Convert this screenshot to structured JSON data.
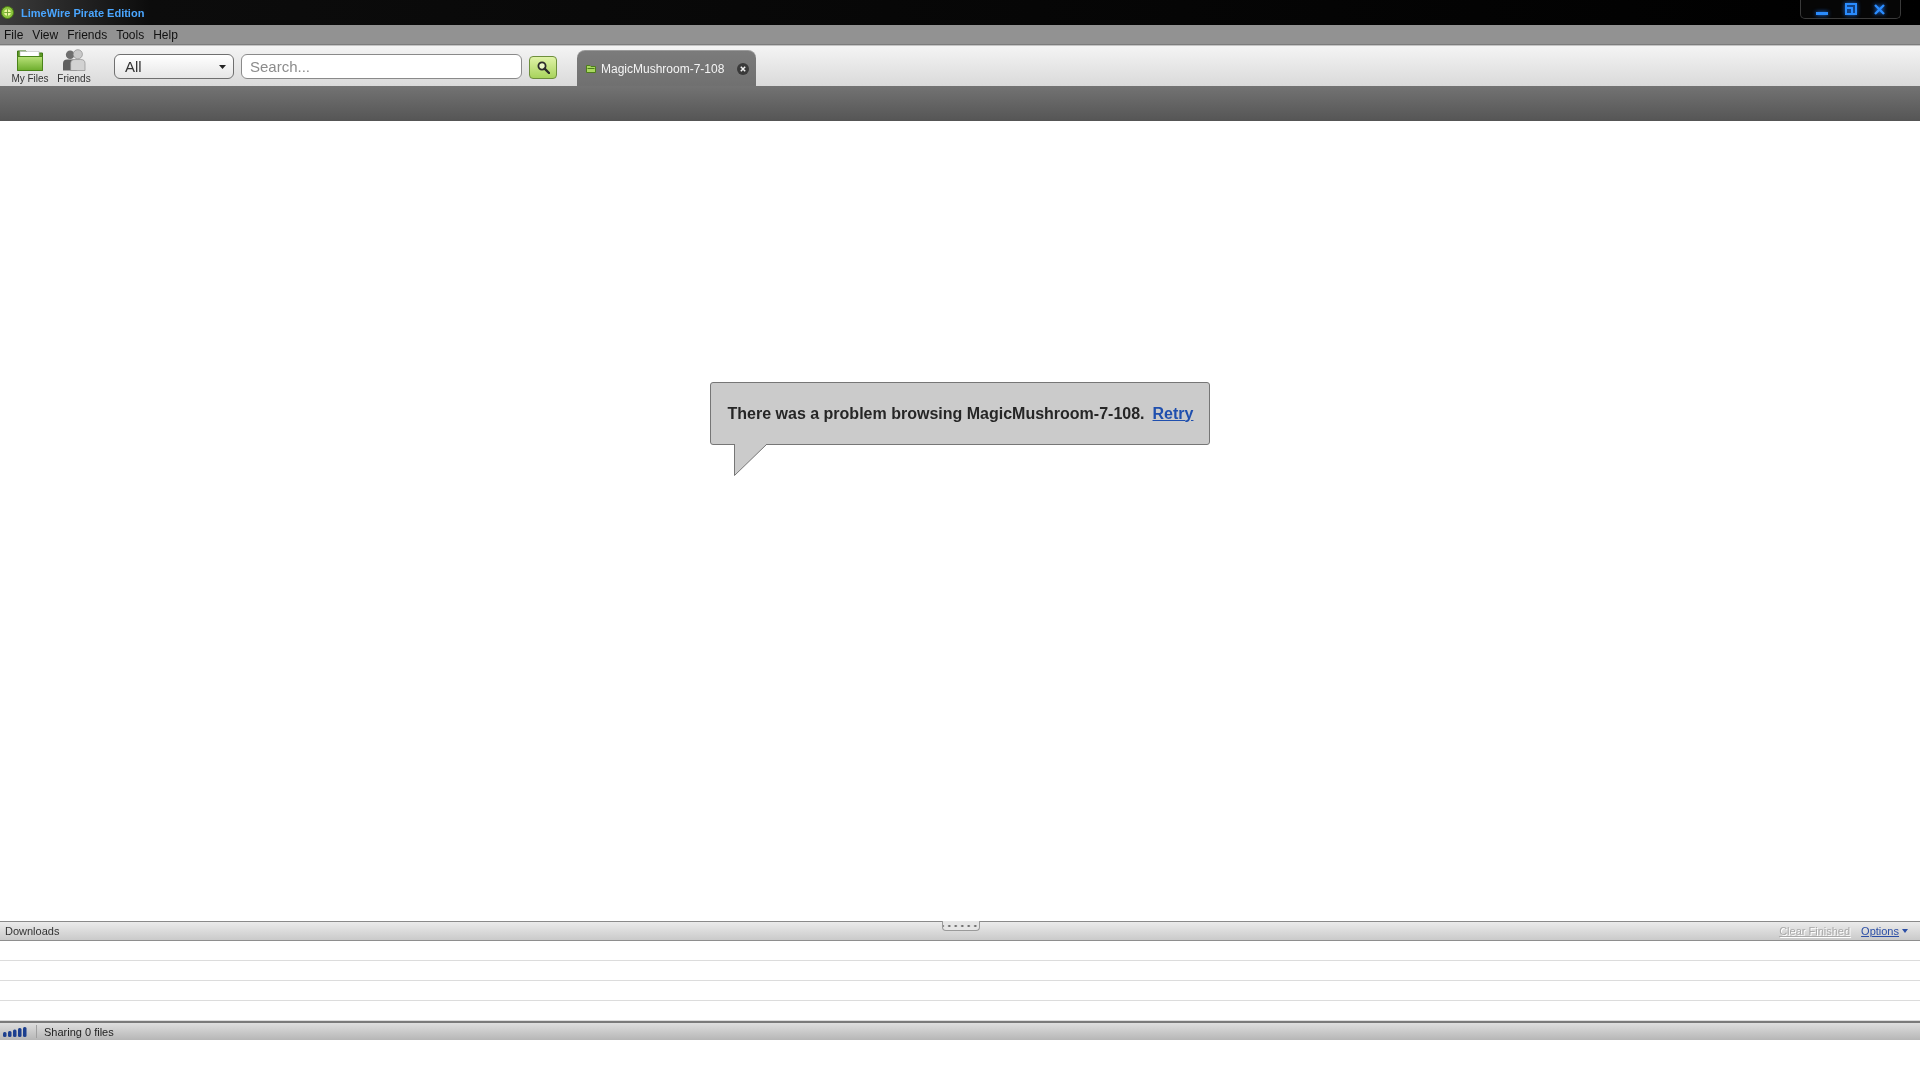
{
  "window": {
    "title": "LimeWire Pirate Edition"
  },
  "menu": [
    "File",
    "View",
    "Friends",
    "Tools",
    "Help"
  ],
  "toolbar": {
    "buttons": [
      {
        "kind": "files",
        "label": "My Files"
      },
      {
        "kind": "friends",
        "label": "Friends"
      }
    ],
    "category": {
      "value": "All"
    },
    "search": {
      "placeholder": "Search..."
    }
  },
  "tabs": [
    {
      "label": "MagicMushroom-7-108",
      "selected": true
    }
  ],
  "message": {
    "text": "There was a problem browsing MagicMushroom-7-108.",
    "link": "Retry"
  },
  "downloads": {
    "title": "Downloads",
    "actions": [
      {
        "kind": "link",
        "label": "Clear Finished",
        "disabled": true
      },
      {
        "kind": "menu",
        "label": "Options",
        "disabled": false
      }
    ]
  },
  "status_bar": {
    "sharing": "Sharing 0 files"
  }
}
